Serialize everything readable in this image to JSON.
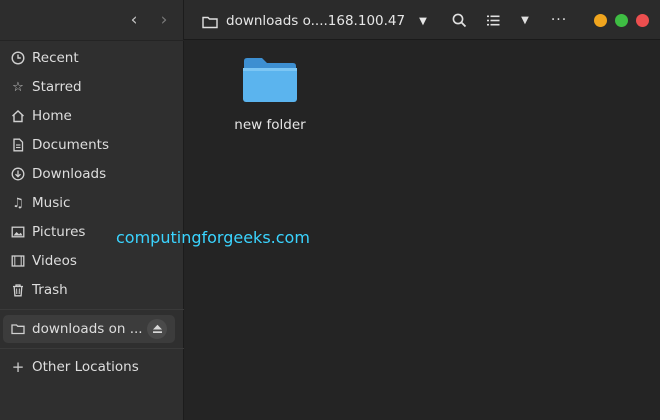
{
  "header": {
    "path_label": "downloads o....168.100.47",
    "back_icon": "chevron-left-icon",
    "forward_icon": "chevron-right-icon",
    "window_controls": {
      "minimize_color": "#f0a51e",
      "maximize_color": "#3ebd43",
      "close_color": "#ec4f4f"
    }
  },
  "sidebar": {
    "items": [
      {
        "label": "Recent",
        "icon": "clock-icon"
      },
      {
        "label": "Starred",
        "icon": "star-icon"
      },
      {
        "label": "Home",
        "icon": "home-icon"
      },
      {
        "label": "Documents",
        "icon": "document-icon"
      },
      {
        "label": "Downloads",
        "icon": "download-icon"
      },
      {
        "label": "Music",
        "icon": "music-icon"
      },
      {
        "label": "Pictures",
        "icon": "picture-icon"
      },
      {
        "label": "Videos",
        "icon": "video-icon"
      },
      {
        "label": "Trash",
        "icon": "trash-icon"
      }
    ],
    "mounted": {
      "label": "downloads on ...",
      "icon": "network-drive-icon"
    },
    "other_locations": {
      "label": "Other Locations",
      "icon": "plus-icon"
    }
  },
  "main": {
    "files": [
      {
        "name": "new folder",
        "icon": "folder-icon",
        "color": "#5bb4ee"
      }
    ],
    "watermark": "computingforgeeks.com"
  }
}
